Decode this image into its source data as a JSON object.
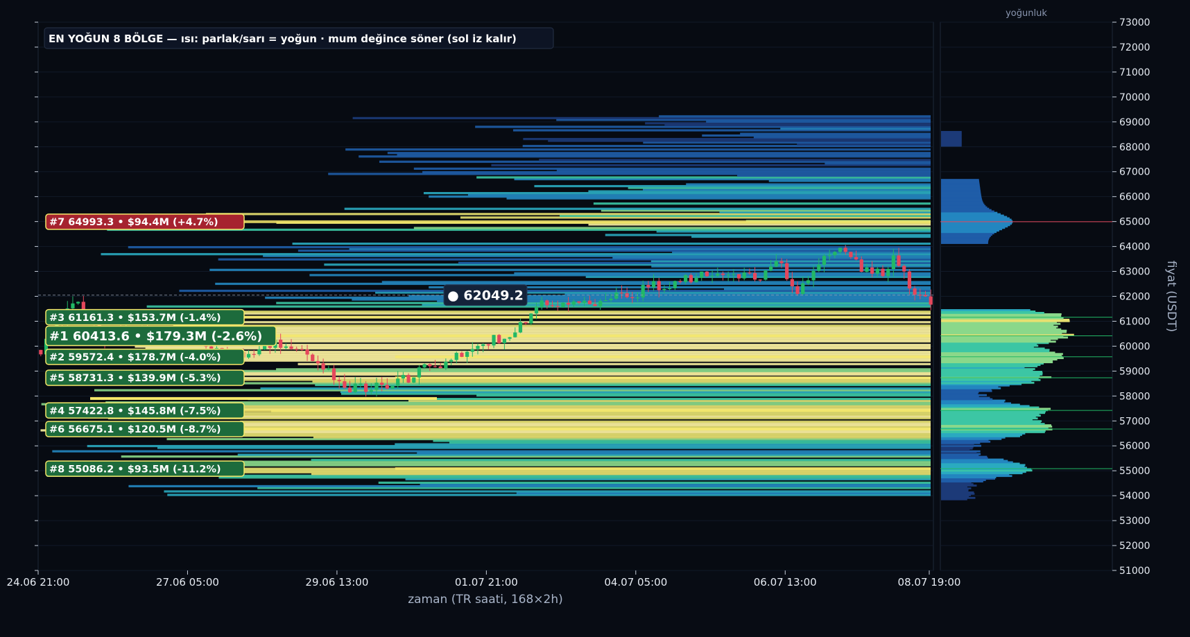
{
  "chart_data": {
    "type": "heatmap",
    "title": "EN YOĞUN 8 BÖLGE — ısı: parlak/sarı = yoğun · mum değince söner (sol iz kalır)",
    "xlabel": "zaman (TR saati, 168×2h)",
    "ylabel": "fiyat (USDT)",
    "side_panel_title": "yoğunluk",
    "ylim": [
      51000,
      73000
    ],
    "y_ticks": [
      "51000",
      "52000",
      "53000",
      "54000",
      "55000",
      "56000",
      "57000",
      "58000",
      "59000",
      "60000",
      "61000",
      "62000",
      "63000",
      "64000",
      "65000",
      "66000",
      "67000",
      "68000",
      "69000",
      "70000",
      "71000",
      "72000",
      "73000"
    ],
    "x_ticks": [
      "24.06 21:00",
      "27.06 05:00",
      "29.06 13:00",
      "01.07 21:00",
      "04.07 05:00",
      "06.07 13:00",
      "08.07 19:00"
    ],
    "x_tick_positions": [
      0,
      28,
      56,
      84,
      112,
      140,
      167
    ],
    "current_price": 62049.2,
    "current_price_label": "● 62049.2",
    "zones": [
      {
        "rank": 7,
        "price": 64993.3,
        "label": "#7  64993.3  •  $94.4M  (+4.7%)",
        "color": "#a6232f"
      },
      {
        "rank": 3,
        "price": 61161.3,
        "label": "#3  61161.3  •  $153.7M  (-1.4%)",
        "color": "#1d6b3c"
      },
      {
        "rank": 1,
        "price": 60413.6,
        "label": "#1  60413.6  •  $179.3M  (-2.6%)",
        "color": "#1d6b3c"
      },
      {
        "rank": 2,
        "price": 59572.4,
        "label": "#2  59572.4  •  $178.7M  (-4.0%)",
        "color": "#1d6b3c"
      },
      {
        "rank": 5,
        "price": 58731.3,
        "label": "#5  58731.3  •  $139.9M  (-5.3%)",
        "color": "#1d6b3c"
      },
      {
        "rank": 4,
        "price": 57422.8,
        "label": "#4  57422.8  •  $145.8M  (-7.5%)",
        "color": "#1d6b3c"
      },
      {
        "rank": 6,
        "price": 56675.1,
        "label": "#6  56675.1  •  $120.5M  (-8.7%)",
        "color": "#1d6b3c"
      },
      {
        "rank": 8,
        "price": 55086.2,
        "label": "#8  55086.2  •  $93.5M  (-11.2%)",
        "color": "#1d6b3c"
      }
    ],
    "candle_path": [
      [
        0,
        59850
      ],
      [
        6,
        61800
      ],
      [
        12,
        60300
      ],
      [
        20,
        60800
      ],
      [
        28,
        60300
      ],
      [
        36,
        59600
      ],
      [
        44,
        60050
      ],
      [
        52,
        59400
      ],
      [
        58,
        58300
      ],
      [
        68,
        58600
      ],
      [
        80,
        59900
      ],
      [
        88,
        60500
      ],
      [
        94,
        61600
      ],
      [
        102,
        61700
      ],
      [
        112,
        62200
      ],
      [
        118,
        62550
      ],
      [
        126,
        62900
      ],
      [
        134,
        62700
      ],
      [
        138,
        63500
      ],
      [
        142,
        62300
      ],
      [
        146,
        63300
      ],
      [
        150,
        64100
      ],
      [
        156,
        62700
      ],
      [
        160,
        63400
      ],
      [
        164,
        62200
      ],
      [
        167,
        61900
      ]
    ],
    "colors": {
      "up": "#22b866",
      "down": "#e5475c",
      "background": "#080c14",
      "accent": "#f5e86a"
    }
  }
}
